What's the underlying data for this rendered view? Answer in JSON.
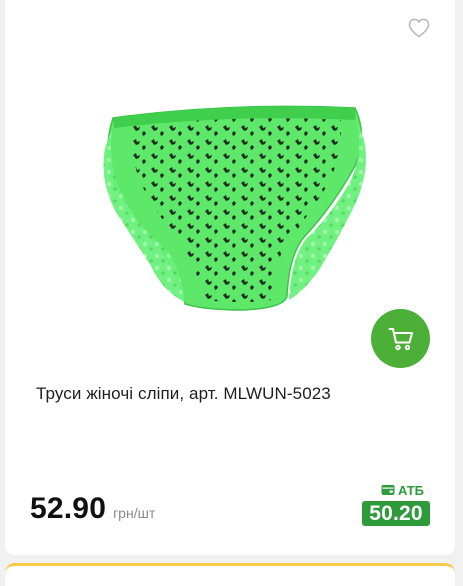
{
  "product": {
    "title": "Труси жіночі сліпи, арт. MLWUN-5023",
    "image_alt": "green women's briefs with black print",
    "favorite_icon": "heart-outline-icon",
    "cart_icon": "cart-icon"
  },
  "pricing": {
    "price": "52.90",
    "unit": "грн/шт",
    "atb_label": "АТБ",
    "atb_icon": "wallet-icon",
    "atb_price": "50.20"
  },
  "colors": {
    "cart_button": "#4caf37",
    "atb_green": "#2f9a3a",
    "product_green": "#5ee86a",
    "accent_yellow": "#f7c948"
  }
}
